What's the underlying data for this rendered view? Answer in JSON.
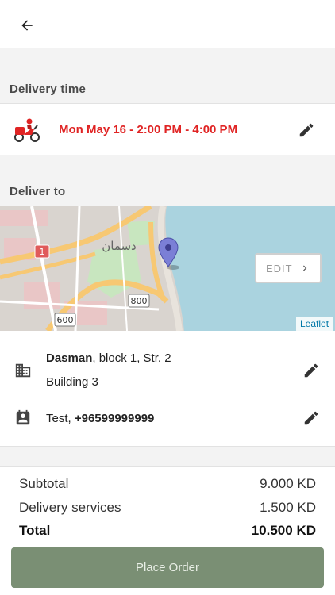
{
  "header": {
    "back_icon": "arrow-left-icon"
  },
  "delivery_time": {
    "section_label": "Delivery time",
    "value": "Mon May 16 - 2:00 PM - 4:00 PM",
    "icon": "delivery-scooter-icon",
    "accent_color": "#e02424"
  },
  "deliver_to": {
    "section_label": "Deliver to",
    "map": {
      "edit_label": "EDIT",
      "attribution": "Leaflet",
      "labels": {
        "district_ar": "دسمان",
        "road_800": "800",
        "road_600": "600",
        "road_1": "1"
      }
    },
    "address": {
      "area": "Dasman",
      "details": ", block 1, Str. 2",
      "building": "Building 3"
    },
    "contact": {
      "name": "Test, ",
      "phone": "+96599999999"
    }
  },
  "summary": {
    "subtotal_label": "Subtotal",
    "subtotal_value": "9.000 KD",
    "delivery_label": "Delivery services",
    "delivery_value": "1.500 KD",
    "total_label": "Total",
    "total_value": "10.500 KD"
  },
  "place_order": {
    "label": "Place Order",
    "color": "#7a8f74"
  }
}
